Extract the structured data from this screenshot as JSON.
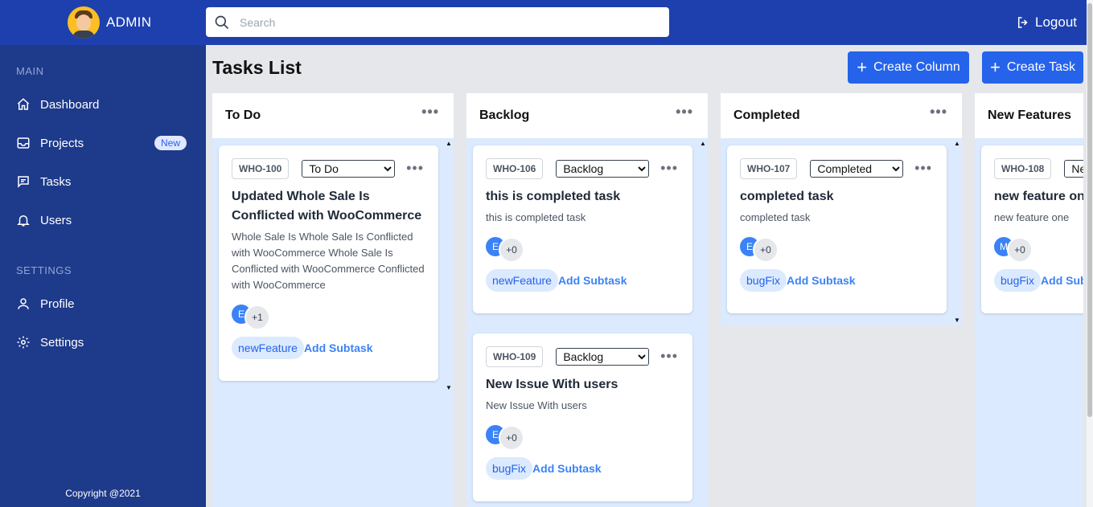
{
  "header": {
    "brand_name": "ADMIN",
    "search_placeholder": "Search",
    "logout_label": "Logout"
  },
  "sidebar": {
    "main_label": "MAIN",
    "settings_label": "SETTINGS",
    "items": [
      {
        "label": "Dashboard",
        "icon": "home-icon"
      },
      {
        "label": "Projects",
        "icon": "inbox-icon",
        "badge": "New"
      },
      {
        "label": "Tasks",
        "icon": "message-icon"
      },
      {
        "label": "Users",
        "icon": "bell-icon"
      },
      {
        "label": "Profile",
        "icon": "user-icon"
      },
      {
        "label": "Settings",
        "icon": "gear-icon"
      }
    ],
    "copyright": "Copyright @2021"
  },
  "main": {
    "title": "Tasks List",
    "create_column_label": "Create Column",
    "create_task_label": "Create Task"
  },
  "columns": [
    {
      "title": "To Do",
      "cards": [
        {
          "id": "WHO-100",
          "status": "To Do",
          "title": "Updated Whole Sale Is Conflicted with WooCommerce",
          "description": "Whole Sale Is Whole Sale Is Conflicted with WooCommerce Whole Sale Is Conflicted with WooCommerce Conflicted with WooCommerce",
          "member": "E",
          "more": "+1",
          "tag": "newFeature",
          "add_subtask": "Add Subtask"
        }
      ]
    },
    {
      "title": "Backlog",
      "cards": [
        {
          "id": "WHO-106",
          "status": "Backlog",
          "title": "this is completed task",
          "description": "this is completed task",
          "member": "E",
          "more": "+0",
          "tag": "newFeature",
          "add_subtask": "Add Subtask"
        },
        {
          "id": "WHO-109",
          "status": "Backlog",
          "title": "New Issue With users",
          "description": "New Issue With users",
          "member": "E",
          "more": "+0",
          "tag": "bugFix",
          "add_subtask": "Add Subtask"
        }
      ]
    },
    {
      "title": "Completed",
      "cards": [
        {
          "id": "WHO-107",
          "status": "Completed",
          "title": "completed task",
          "description": "completed task",
          "member": "E",
          "more": "+0",
          "tag": "bugFix",
          "add_subtask": "Add Subtask"
        }
      ]
    },
    {
      "title": "New Features",
      "cards": [
        {
          "id": "WHO-108",
          "status": "New Features",
          "title": "new feature one",
          "description": "new feature one",
          "member": "M",
          "more": "+0",
          "tag": "bugFix",
          "add_subtask": "Add Subtask"
        }
      ]
    }
  ],
  "status_options": [
    "To Do",
    "Backlog",
    "Completed",
    "New Features"
  ],
  "colors": {
    "header_bg": "#1e40af",
    "sidebar_bg": "#1e3a8a",
    "accent": "#2563eb",
    "column_bg": "#dbeafe"
  }
}
